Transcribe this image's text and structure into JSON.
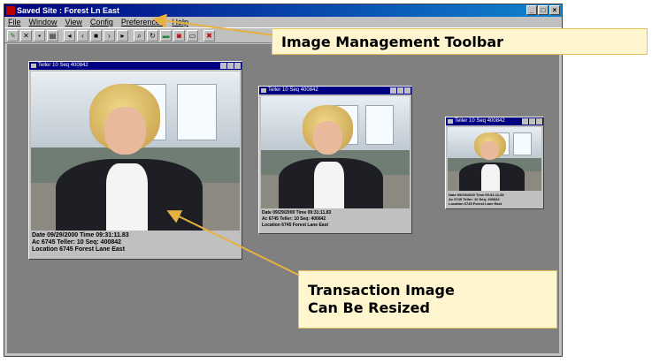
{
  "window": {
    "title": "Saved Site : Forest Ln East"
  },
  "menu": [
    "File",
    "Window",
    "View",
    "Config",
    "Preferences",
    "Help"
  ],
  "toolbar": {
    "buttons": [
      "edit-icon",
      "delete-icon",
      "save-icon",
      "print-icon",
      "first-icon",
      "prev-icon",
      "stop-icon",
      "next-icon",
      "last-icon",
      "zoom-icon",
      "refresh-icon",
      "record-icon",
      "camera-icon",
      "tile-icon",
      "close-red-icon"
    ]
  },
  "children": [
    {
      "title": "Teller 10 Seq 400842",
      "caption": [
        "Date 09/29/2000   Time  09:31:11.83",
        "Ac 6745  Teller: 10  Seq: 400842",
        "Location 6745 Forest Lane East"
      ]
    },
    {
      "title": "Teller 10 Seq 400842",
      "caption": [
        "Date 09/29/2000   Time  09:31:11.83",
        "Ac 6745  Teller: 10  Seq: 400842",
        "Location 6745 Forest Lane East"
      ]
    },
    {
      "title": "Teller 10 Seq 400842",
      "caption": [
        "Date 09/29/2000  Time 09:31:11.83",
        "Ac 6745  Teller: 10  Seq: 400842",
        "Location 6745 Forest Lane East"
      ]
    }
  ],
  "callouts": {
    "toolbar": "Image Management Toolbar",
    "resize_line1": "Transaction Image",
    "resize_line2": "Can Be Resized"
  },
  "colors": {
    "callout_fill": "#fff6cf",
    "arrow": "#e8b040",
    "workspace": "#808080",
    "titlebar": "#000080"
  }
}
